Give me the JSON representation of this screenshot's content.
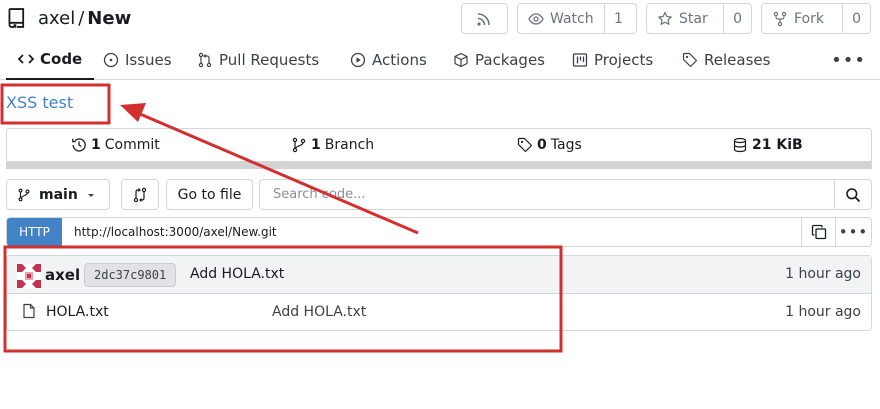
{
  "repo": {
    "owner": "axel",
    "separator": "/",
    "name": "New"
  },
  "header_buttons": {
    "rss_icon": "rss-icon",
    "watch_label": "Watch",
    "watch_count": "1",
    "star_label": "Star",
    "star_count": "0",
    "fork_label": "Fork",
    "fork_count": "0"
  },
  "tabs": [
    {
      "label": "Code",
      "icon": "code-icon",
      "active": true
    },
    {
      "label": "Issues",
      "icon": "issue-icon"
    },
    {
      "label": "Pull Requests",
      "icon": "pull-request-icon"
    },
    {
      "label": "Actions",
      "icon": "play-icon"
    },
    {
      "label": "Packages",
      "icon": "package-icon"
    },
    {
      "label": "Projects",
      "icon": "project-icon"
    },
    {
      "label": "Releases",
      "icon": "tag-icon"
    }
  ],
  "description": "XSS test",
  "stats": {
    "commits_count": "1",
    "commits_label": "Commit",
    "branches_count": "1",
    "branches_label": "Branch",
    "tags_count": "0",
    "tags_label": "Tags",
    "size_value": "21 KiB"
  },
  "toolbar": {
    "branch": "main",
    "go_to_file": "Go to file",
    "search_placeholder": "Search code..."
  },
  "clone": {
    "protocol": "HTTP",
    "url": "http://localhost:3000/axel/New.git"
  },
  "latest_commit": {
    "author": "axel",
    "sha": "2dc37c9801",
    "message": "Add HOLA.txt",
    "time": "1 hour ago"
  },
  "files": [
    {
      "name": "HOLA.txt",
      "message": "Add HOLA.txt",
      "time": "1 hour ago"
    }
  ],
  "colors": {
    "accent": "#4183c4",
    "annotation": "#d32f2f"
  }
}
